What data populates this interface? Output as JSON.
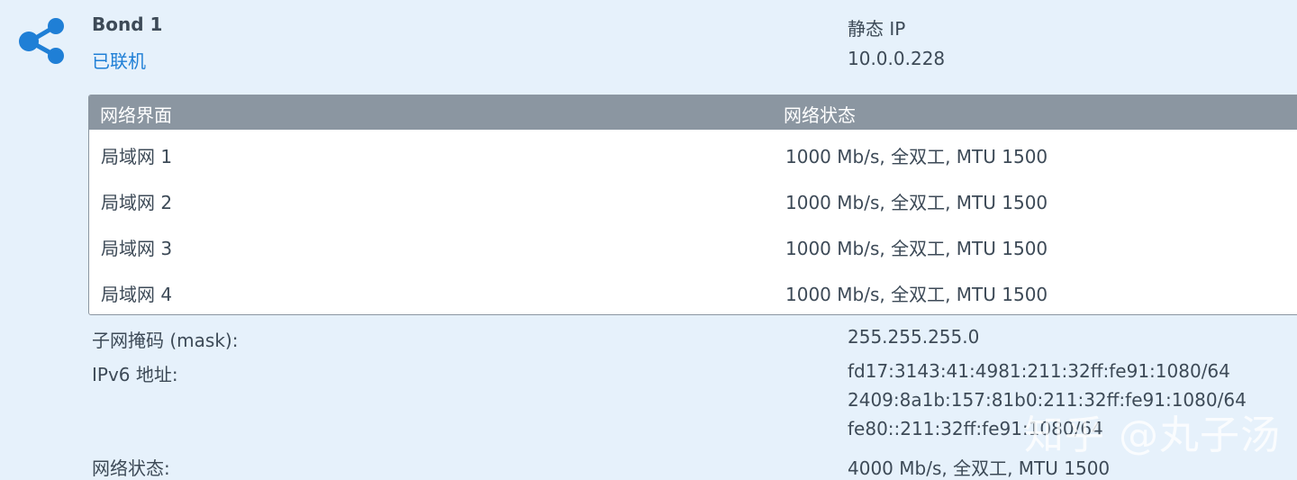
{
  "bond": {
    "title": "Bond 1",
    "status": "已联机",
    "ip_mode": "静态 IP",
    "ip_address": "10.0.0.228",
    "icon": "share-network-icon",
    "status_color": "#1f7fd6"
  },
  "interfaces": {
    "header": {
      "name": "网络界面",
      "state": "网络状态"
    },
    "rows": [
      {
        "name": "局域网 1",
        "state": "1000 Mb/s, 全双工, MTU 1500"
      },
      {
        "name": "局域网 2",
        "state": "1000 Mb/s, 全双工, MTU 1500"
      },
      {
        "name": "局域网 3",
        "state": "1000 Mb/s, 全双工, MTU 1500"
      },
      {
        "name": "局域网 4",
        "state": "1000 Mb/s, 全双工, MTU 1500"
      }
    ]
  },
  "details": {
    "subnet_label": "子网掩码 (mask):",
    "subnet_value": "255.255.255.0",
    "ipv6_label": "IPv6 地址:",
    "ipv6_values": [
      "fd17:3143:41:4981:211:32ff:fe91:1080/64",
      "2409:8a1b:157:81b0:211:32ff:fe91:1080/64",
      "fe80::211:32ff:fe91:1080/64"
    ],
    "net_state_label": "网络状态:",
    "net_state_value": "4000 Mb/s, 全双工, MTU 1500"
  },
  "watermark": "知乎 @丸子汤"
}
